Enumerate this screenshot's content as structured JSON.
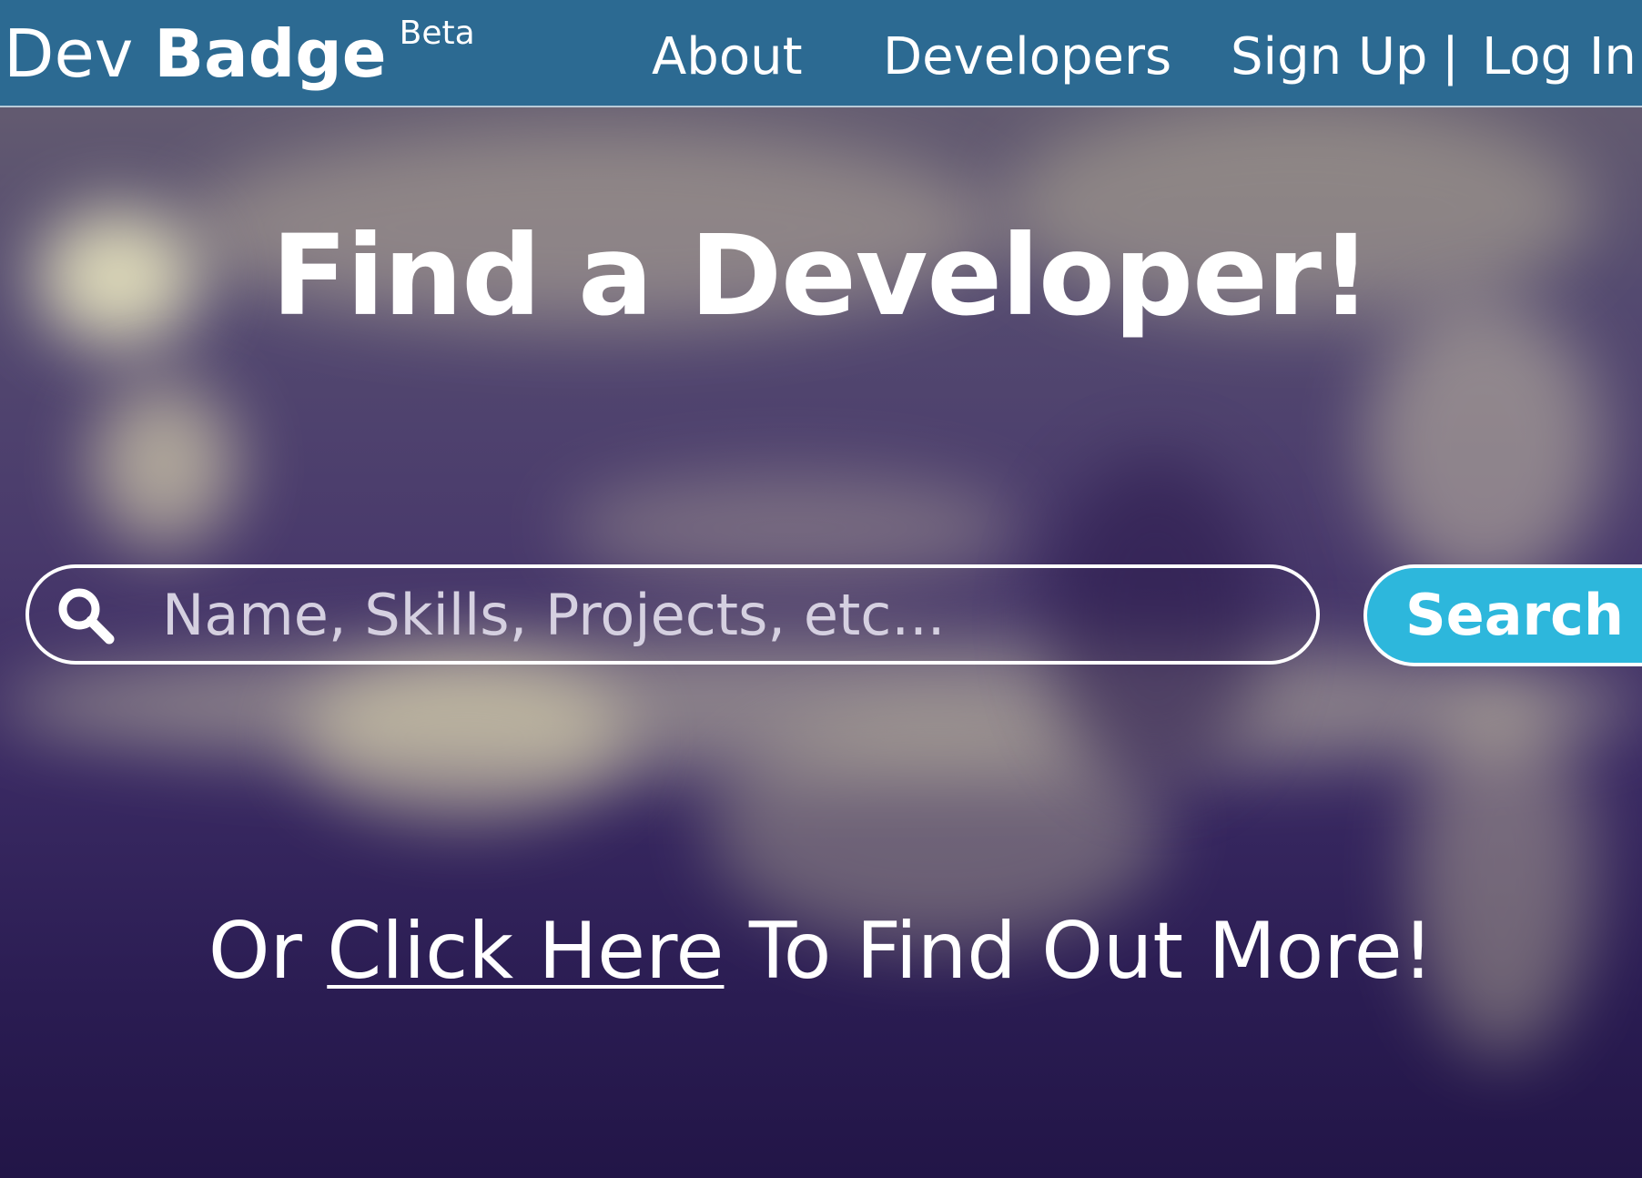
{
  "navbar": {
    "brand_light": "Dev",
    "brand_bold": "Badge",
    "brand_tag": "Beta",
    "links": [
      {
        "label": "About"
      },
      {
        "label": "Developers"
      },
      {
        "label": "Sign Up"
      },
      {
        "label": "|"
      },
      {
        "label": "Log In"
      }
    ],
    "background_color": "#2c6a92"
  },
  "hero": {
    "title": "Find a Developer!",
    "search": {
      "placeholder": "Name, Skills, Projects, etc...",
      "value": "",
      "icon": "search-icon",
      "button_label": "Search",
      "button_color": "#2db7dc"
    },
    "findout": {
      "prefix": "Or",
      "link_label": "Click Here",
      "suffix": "To Find Out More!"
    }
  }
}
